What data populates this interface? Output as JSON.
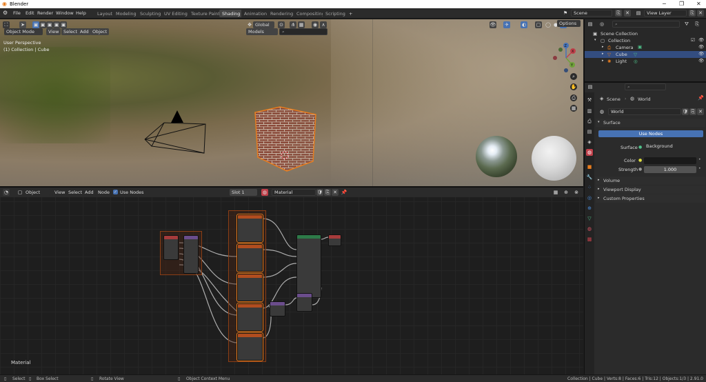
{
  "app": {
    "window_title": "Blender",
    "menus": [
      "File",
      "Edit",
      "Render",
      "Window",
      "Help"
    ],
    "workspaces": [
      "Layout",
      "Modeling",
      "Sculpting",
      "UV Editing",
      "Texture Paint",
      "Shading",
      "Animation",
      "Rendering",
      "Compositing",
      "Scripting"
    ],
    "active_workspace": "Shading",
    "scene_label": "Scene",
    "view_layer_label": "View Layer"
  },
  "viewport": {
    "mode": "Object Mode",
    "menus": [
      "View",
      "Select",
      "Add",
      "Object"
    ],
    "orientation": "Global",
    "models_dropdown": "Models",
    "options_label": "Options",
    "overlay_text_1": "User Perspective",
    "overlay_text_2": "(1) Collection | Cube",
    "axis_labels": [
      "Y",
      "X",
      "Z"
    ]
  },
  "node_editor": {
    "editor_type": "Object",
    "menus": [
      "View",
      "Select",
      "Add",
      "Node"
    ],
    "use_nodes_label": "Use Nodes",
    "slot": "Slot 1",
    "material_name": "Material",
    "overlay_label": "Material"
  },
  "outliner": {
    "root": "Scene Collection",
    "items": [
      {
        "label": "Collection",
        "indent": 1
      },
      {
        "label": "Camera",
        "indent": 2
      },
      {
        "label": "Cube",
        "indent": 2,
        "selected": true
      },
      {
        "label": "Light",
        "indent": 2
      }
    ]
  },
  "properties": {
    "breadcrumb_scene": "Scene",
    "breadcrumb_world": "World",
    "world_name": "World",
    "surface_panel": "Surface",
    "use_nodes_button": "Use Nodes",
    "surface_label": "Surface",
    "surface_value": "Background",
    "color_label": "Color",
    "strength_label": "Strength",
    "strength_value": "1.000",
    "collapsed_panels": [
      "Volume",
      "Viewport Display",
      "Custom Properties"
    ]
  },
  "statusbar": {
    "select": "Select",
    "box_select": "Box Select",
    "rotate_view": "Rotate View",
    "context_menu": "Object Context Menu",
    "stats": "Collection | Cube | Verts:8 | Faces:6 | Tris:12 | Objects:1/3 | 2.91.0"
  },
  "colors": {
    "accent_blue": "#4772b3",
    "selection_orange": "#e87d1e",
    "frame_border": "#8b3e15",
    "node_header_orange": "#b14d1f",
    "node_header_green": "#2d7a48",
    "node_header_red": "#a63b3b",
    "node_header_purple": "#6b4d8c"
  }
}
